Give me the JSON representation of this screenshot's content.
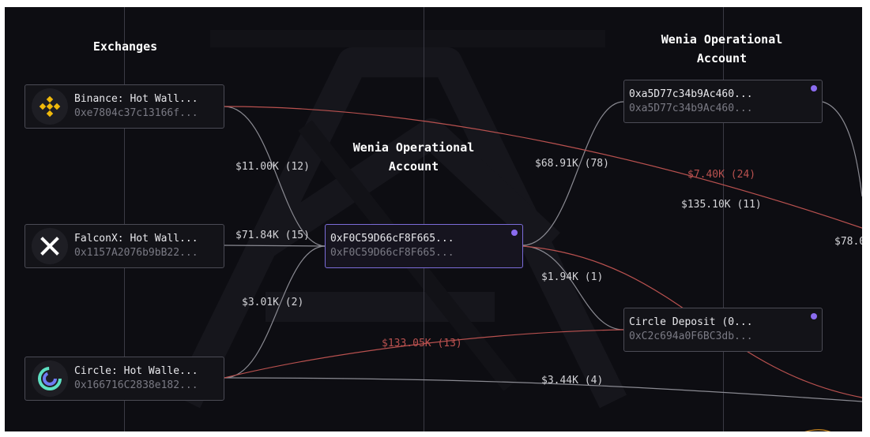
{
  "columns": [
    {
      "title": "Exchanges"
    },
    {
      "title": "Wenia Operational\nAccount"
    },
    {
      "title": "Wenia Operational\nAccount"
    }
  ],
  "nodes": {
    "binance": {
      "name": "Binance: Hot Wall...",
      "address": "0xe7804c37c13166f...",
      "logo": "binance-logo"
    },
    "falconx": {
      "name": "FalconX: Hot Wall...",
      "address": "0x1157A2076b9bB22...",
      "logo": "falconx-logo"
    },
    "circle": {
      "name": "Circle: Hot Walle...",
      "address": "0x166716C2838e182...",
      "logo": "circle-logo"
    },
    "wenia_mid": {
      "name": "0xF0C59D66cF8F665...",
      "address": "0xF0C59D66cF8F665..."
    },
    "wenia_right": {
      "name": "0xa5D77c34b9Ac460...",
      "address": "0xa5D77c34b9Ac460..."
    },
    "circle_deposit": {
      "name": "Circle Deposit (0...",
      "address": "0xC2c694a0F6BC3db..."
    }
  },
  "edge_labels": {
    "binance_mid": "$11.00K (12)",
    "falconx_mid": "$71.84K (15)",
    "circle_mid": "$3.01K (2)",
    "mid_right": "$68.91K (78)",
    "binance_far": "$7.40K (24)",
    "right_deposit": "$135.10K (11)",
    "right_far": "$78.0",
    "mid_deposit": "$1.94K (1)",
    "deposit_circle": "$133.05K (13)",
    "circle_far": "$3.44K (4)"
  },
  "colors": {
    "background": "#0d0d12",
    "edge_default": "#8a8a92",
    "edge_return": "#b9514f",
    "selected_border": "#7b6cd9",
    "dot": "#8b6cf0",
    "binance": "#f0b90b",
    "circle_a": "#5ee1c2",
    "circle_b": "#6f7bf2"
  }
}
